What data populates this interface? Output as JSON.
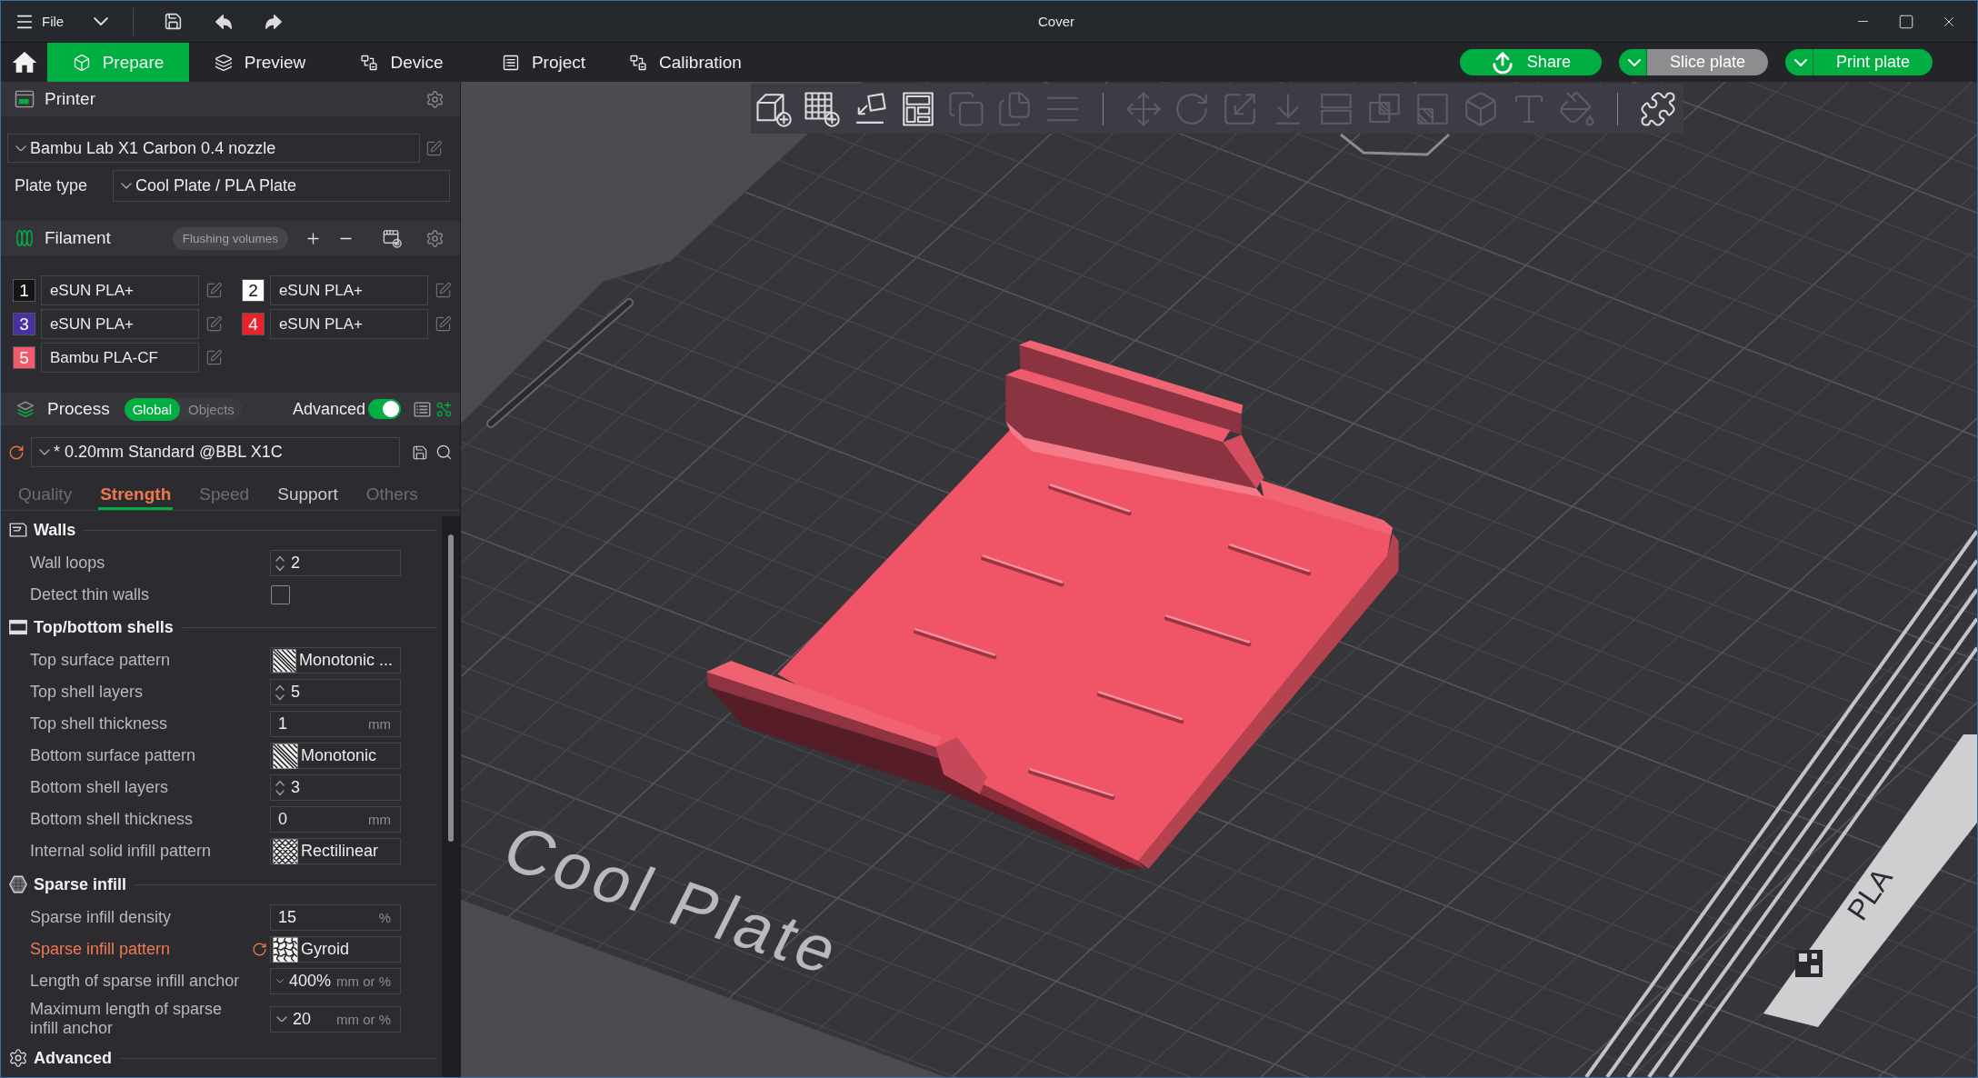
{
  "window": {
    "title": "Cover",
    "menu": "File"
  },
  "main_tabs": [
    {
      "label": "Prepare",
      "selected": true
    },
    {
      "label": "Preview",
      "selected": false
    },
    {
      "label": "Device",
      "selected": false
    },
    {
      "label": "Project",
      "selected": false
    },
    {
      "label": "Calibration",
      "selected": false
    }
  ],
  "actions": [
    {
      "kind": "share",
      "label": "Share"
    },
    {
      "kind": "split",
      "label": "Slice plate",
      "disabled": true
    },
    {
      "kind": "split",
      "label": "Print plate",
      "disabled": false
    }
  ],
  "printer": {
    "title": "Printer",
    "preset": "Bambu Lab X1 Carbon 0.4 nozzle",
    "plate_type_label": "Plate type",
    "plate_type": "Cool Plate / PLA Plate"
  },
  "filament": {
    "title": "Filament",
    "flushing_button": "Flushing volumes",
    "slots": [
      {
        "number": "1",
        "name": "eSUN PLA+",
        "color": "#151515"
      },
      {
        "number": "2",
        "name": "eSUN PLA+",
        "color": "#ffffff"
      },
      {
        "number": "3",
        "name": "eSUN PLA+",
        "color": "#4a31a3"
      },
      {
        "number": "4",
        "name": "eSUN PLA+",
        "color": "#e8232b"
      },
      {
        "number": "5",
        "name": "Bambu PLA-CF",
        "color": "#f25a6c"
      }
    ]
  },
  "process": {
    "title": "Process",
    "scopes": [
      {
        "label": "Global",
        "selected": true
      },
      {
        "label": "Objects",
        "selected": false
      }
    ],
    "advanced_label": "Advanced",
    "advanced": true,
    "preset": "* 0.20mm Standard @BBL X1C",
    "modified": true,
    "tabs": [
      {
        "label": "Quality",
        "selected": false,
        "dimmed": true
      },
      {
        "label": "Strength",
        "selected": true,
        "dimmed": false
      },
      {
        "label": "Speed",
        "selected": false,
        "dimmed": true
      },
      {
        "label": "Support",
        "selected": false,
        "dimmed": false
      },
      {
        "label": "Others",
        "selected": false,
        "dimmed": true
      }
    ],
    "groups": [
      {
        "title": "Walls",
        "settings": [
          {
            "label": "Wall loops",
            "kind": "spin",
            "value": "2",
            "modified": false
          },
          {
            "label": "Detect thin walls",
            "kind": "checkbox",
            "checked": false,
            "modified": false
          }
        ]
      },
      {
        "title": "Top/bottom shells",
        "settings": [
          {
            "label": "Top surface pattern",
            "kind": "pattern",
            "value": "Monotonic ...",
            "modified": false
          },
          {
            "label": "Top shell layers",
            "kind": "spin",
            "value": "5",
            "modified": false
          },
          {
            "label": "Top shell thickness",
            "kind": "unit",
            "value": "1",
            "unit": "mm",
            "modified": false
          },
          {
            "label": "Bottom surface pattern",
            "kind": "pattern",
            "value": "Monotonic",
            "modified": false
          },
          {
            "label": "Bottom shell layers",
            "kind": "spin",
            "value": "3",
            "modified": false
          },
          {
            "label": "Bottom shell thickness",
            "kind": "unit",
            "value": "0",
            "unit": "mm",
            "modified": false
          },
          {
            "label": "Internal solid infill pattern",
            "kind": "pattern",
            "value": "Rectilinear",
            "modified": false
          }
        ]
      },
      {
        "title": "Sparse infill",
        "settings": [
          {
            "label": "Sparse infill density",
            "kind": "unit",
            "value": "15",
            "unit": "%",
            "modified": false
          },
          {
            "label": "Sparse infill pattern",
            "kind": "pattern",
            "value": "Gyroid",
            "modified": true
          },
          {
            "label": "Length of sparse infill anchor",
            "kind": "combo",
            "value": "400%",
            "unit": "mm or %",
            "modified": false
          },
          {
            "label": "Maximum length of sparse infill anchor",
            "kind": "combo",
            "value": "20",
            "unit": "mm or %",
            "modified": false
          }
        ]
      },
      {
        "title": "Advanced"
      }
    ]
  },
  "canvas": {
    "plate_label": "Cool Plate",
    "plate_badge": "PLA",
    "toolbar": [
      {
        "tools": [
          {
            "disabled": false
          },
          {
            "disabled": false
          },
          {
            "disabled": false
          },
          {
            "disabled": false
          },
          {
            "disabled": true
          },
          {
            "disabled": true
          },
          {
            "disabled": true
          }
        ]
      },
      {
        "tools": [
          {
            "disabled": true
          },
          {
            "disabled": true
          },
          {
            "disabled": true
          },
          {
            "disabled": true
          },
          {
            "disabled": true
          },
          {
            "disabled": true
          },
          {
            "disabled": true
          },
          {
            "disabled": true
          },
          {
            "disabled": true
          },
          {
            "disabled": true
          }
        ]
      },
      {
        "tools": [
          {
            "disabled": false
          }
        ]
      }
    ]
  }
}
